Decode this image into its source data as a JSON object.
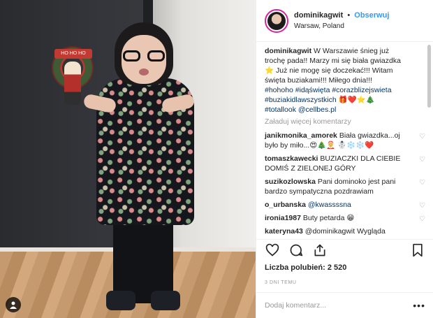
{
  "header": {
    "username": "dominikagwit",
    "separator": "•",
    "follow_label": "Obserwuj",
    "location": "Warsaw, Poland"
  },
  "caption": {
    "username": "dominikagwit",
    "text": "W Warszawie śnieg już trochę pada!! Marzy mi się biała gwiazdka ⭐ Już nie mogę się doczekać!!! Witam święta buziakami!!! Miłego dnia!!!",
    "hashtags_line1": "#hohoho #idąświęta #corazblizejswieta",
    "hashtags_line2": "#buziakidlawszystkich 🎁❤️⭐🎄",
    "totallook": "#totallook @cellbes.pl"
  },
  "load_more": "Załaduj więcej komentarzy",
  "comments": [
    {
      "username": "janikmonika_amorek",
      "text": "Biała gwiazdka...oj było by miło...😍🎄🤶 ☃️❄️❄️❤️"
    },
    {
      "username": "tomaszkawecki",
      "text": "BUZIACZKI DLA CIEBIE DOMIŚ Z ZIELONEJ GÓRY"
    },
    {
      "username": "suzikozlowska",
      "text": "Pani dominoko jest pani bardzo sympatyczna pozdrawiam"
    },
    {
      "username": "o_urbanska",
      "text": "@kwassssna"
    },
    {
      "username": "ironia1987",
      "text": "Buty petarda 😁"
    },
    {
      "username": "kateryna43",
      "text": "@dominikagwit Wygląda"
    }
  ],
  "likes": "Liczba polubień: 2 520",
  "timestamp": "3 DNI TEMU",
  "add_comment_placeholder": "Dodaj komentarz...",
  "more_options": "•••",
  "photo": {
    "wreath_text": "HO HO HO"
  },
  "icons": {
    "like": "heart-icon",
    "comment": "comment-icon",
    "share": "share-icon",
    "save": "bookmark-icon"
  },
  "colors": {
    "accent": "#3897f0",
    "text": "#262626",
    "muted": "#999999",
    "border": "#efefef"
  }
}
